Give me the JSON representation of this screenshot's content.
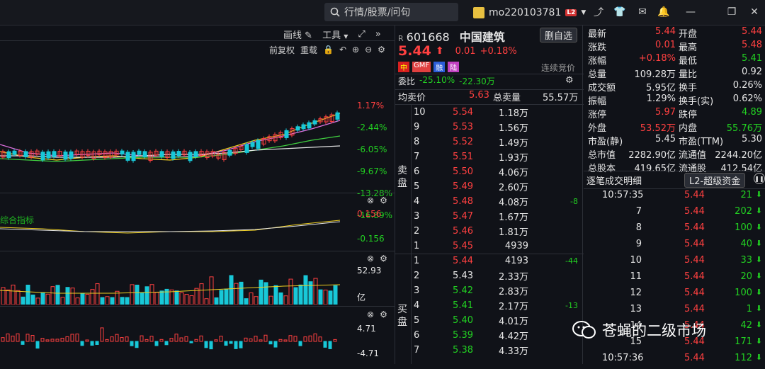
{
  "topbar": {
    "search_placeholder": "行情/股票/问句",
    "username": "mo220103781",
    "badge": "L2"
  },
  "chart_toolbar": {
    "draw_label": "画线",
    "tools_label": "工具",
    "adjust_label": "前复权",
    "reset_label": "重载"
  },
  "kline": {
    "axis_pct": [
      "1.17%",
      "-2.44%",
      "-6.05%",
      "-9.67%",
      "-13.28%",
      "-16.89%"
    ]
  },
  "macd": {
    "label": "综合指标",
    "axis": [
      "0.156",
      "-0.156"
    ]
  },
  "volume": {
    "axis_top": "52.93",
    "axis_unit": "亿"
  },
  "indicator3": {
    "axis": [
      "4.71",
      "-4.71"
    ]
  },
  "quote_header": {
    "tag": "R",
    "code": "601668",
    "name": "中国建筑",
    "watchlist_button": "删自选",
    "price": "5.44",
    "change": "0.01",
    "change_pct": "+0.18%",
    "tags": [
      "中",
      "GMF",
      "融",
      "陆"
    ],
    "auction_label": "连续竞价",
    "weibi_label": "委比",
    "weibi_value": "-25.10%",
    "weicha_value": "-22.30万",
    "avg_label": "均卖价",
    "avg_value": "5.63",
    "total_label": "总卖量",
    "total_value": "55.57万",
    "sell_label": "卖盘",
    "buy_label": "买盘"
  },
  "asks": [
    {
      "level": "10",
      "price": "5.54",
      "vol": "1.18万",
      "chg": ""
    },
    {
      "level": "9",
      "price": "5.53",
      "vol": "1.56万",
      "chg": ""
    },
    {
      "level": "8",
      "price": "5.52",
      "vol": "1.49万",
      "chg": ""
    },
    {
      "level": "7",
      "price": "5.51",
      "vol": "1.93万",
      "chg": ""
    },
    {
      "level": "6",
      "price": "5.50",
      "vol": "4.06万",
      "chg": ""
    },
    {
      "level": "5",
      "price": "5.49",
      "vol": "2.60万",
      "chg": ""
    },
    {
      "level": "4",
      "price": "5.48",
      "vol": "4.08万",
      "chg": "-8"
    },
    {
      "level": "3",
      "price": "5.47",
      "vol": "1.67万",
      "chg": ""
    },
    {
      "level": "2",
      "price": "5.46",
      "vol": "1.81万",
      "chg": ""
    },
    {
      "level": "1",
      "price": "5.45",
      "vol": "4939",
      "chg": ""
    }
  ],
  "bids": [
    {
      "level": "1",
      "price": "5.44",
      "vol": "4193",
      "chg": "-44",
      "color": "#ff4040"
    },
    {
      "level": "2",
      "price": "5.43",
      "vol": "2.33万",
      "chg": "",
      "color": "#e6e6e6"
    },
    {
      "level": "3",
      "price": "5.42",
      "vol": "2.83万",
      "chg": "",
      "color": "#22d022"
    },
    {
      "level": "4",
      "price": "5.41",
      "vol": "2.17万",
      "chg": "-13",
      "color": "#22d022"
    },
    {
      "level": "5",
      "price": "5.40",
      "vol": "4.01万",
      "chg": "",
      "color": "#22d022"
    },
    {
      "level": "6",
      "price": "5.39",
      "vol": "4.42万",
      "chg": "",
      "color": "#22d022"
    },
    {
      "level": "7",
      "price": "5.38",
      "vol": "4.33万",
      "chg": "",
      "color": "#22d022"
    }
  ],
  "stats": [
    {
      "l1": "最新",
      "v1": "5.44",
      "c1": "#ff4040",
      "l2": "开盘",
      "v2": "5.44",
      "c2": "#ff4040"
    },
    {
      "l1": "涨跌",
      "v1": "0.01",
      "c1": "#ff4040",
      "l2": "最高",
      "v2": "5.48",
      "c2": "#ff4040"
    },
    {
      "l1": "涨幅",
      "v1": "+0.18%",
      "c1": "#ff4040",
      "l2": "最低",
      "v2": "5.41",
      "c2": "#22d022"
    },
    {
      "l1": "总量",
      "v1": "109.28万",
      "c1": "#e6e6e6",
      "l2": "量比",
      "v2": "0.92",
      "c2": "#e6e6e6"
    },
    {
      "l1": "成交额",
      "v1": "5.95亿",
      "c1": "#e6e6e6",
      "l2": "换手",
      "v2": "0.26%",
      "c2": "#e6e6e6"
    },
    {
      "l1": "振幅",
      "v1": "1.29%",
      "c1": "#e6e6e6",
      "l2": "换手(实)",
      "v2": "0.62%",
      "c2": "#e6e6e6"
    },
    {
      "l1": "涨停",
      "v1": "5.97",
      "c1": "#ff4040",
      "l2": "跌停",
      "v2": "4.89",
      "c2": "#22d022"
    },
    {
      "l1": "外盘",
      "v1": "53.52万",
      "c1": "#ff4040",
      "l2": "内盘",
      "v2": "55.76万",
      "c2": "#22d022"
    },
    {
      "l1": "市盈(静)",
      "v1": "5.45",
      "c1": "#e6e6e6",
      "l2": "市盈(TTM)",
      "v2": "5.30",
      "c2": "#e6e6e6"
    },
    {
      "l1": "总市值",
      "v1": "2282.90亿",
      "c1": "#e6e6e6",
      "l2": "流通值",
      "v2": "2244.20亿",
      "c2": "#e6e6e6"
    },
    {
      "l1": "总股本",
      "v1": "419.65亿",
      "c1": "#e6e6e6",
      "l2": "流通股",
      "v2": "412.54亿",
      "c2": "#e6e6e6"
    }
  ],
  "trades_header": {
    "title": "逐笔成交明细",
    "button": "L2-超级资金"
  },
  "trades": [
    {
      "time": "10:57:35",
      "price": "5.44",
      "vol": "21",
      "dir": "down"
    },
    {
      "time": "7",
      "price": "5.44",
      "vol": "202",
      "dir": "down"
    },
    {
      "time": "8",
      "price": "5.44",
      "vol": "100",
      "dir": "down"
    },
    {
      "time": "9",
      "price": "5.44",
      "vol": "40",
      "dir": "down"
    },
    {
      "time": "10",
      "price": "5.44",
      "vol": "33",
      "dir": "down"
    },
    {
      "time": "11",
      "price": "5.44",
      "vol": "20",
      "dir": "down"
    },
    {
      "time": "12",
      "price": "5.44",
      "vol": "100",
      "dir": "down"
    },
    {
      "time": "13",
      "price": "5.44",
      "vol": "1",
      "dir": "down"
    },
    {
      "time": "14",
      "price": "5.44",
      "vol": "42",
      "dir": "down"
    },
    {
      "time": "15",
      "price": "5.44",
      "vol": "171",
      "dir": "down"
    },
    {
      "time": "10:57:36",
      "price": "5.44",
      "vol": "112",
      "dir": "down"
    }
  ],
  "watermark": "苍蝇的二级市场",
  "colors": {
    "up": "#ff4040",
    "down": "#22d022",
    "vol_up": "#ff4040",
    "vol_down": "#18c8d8"
  }
}
